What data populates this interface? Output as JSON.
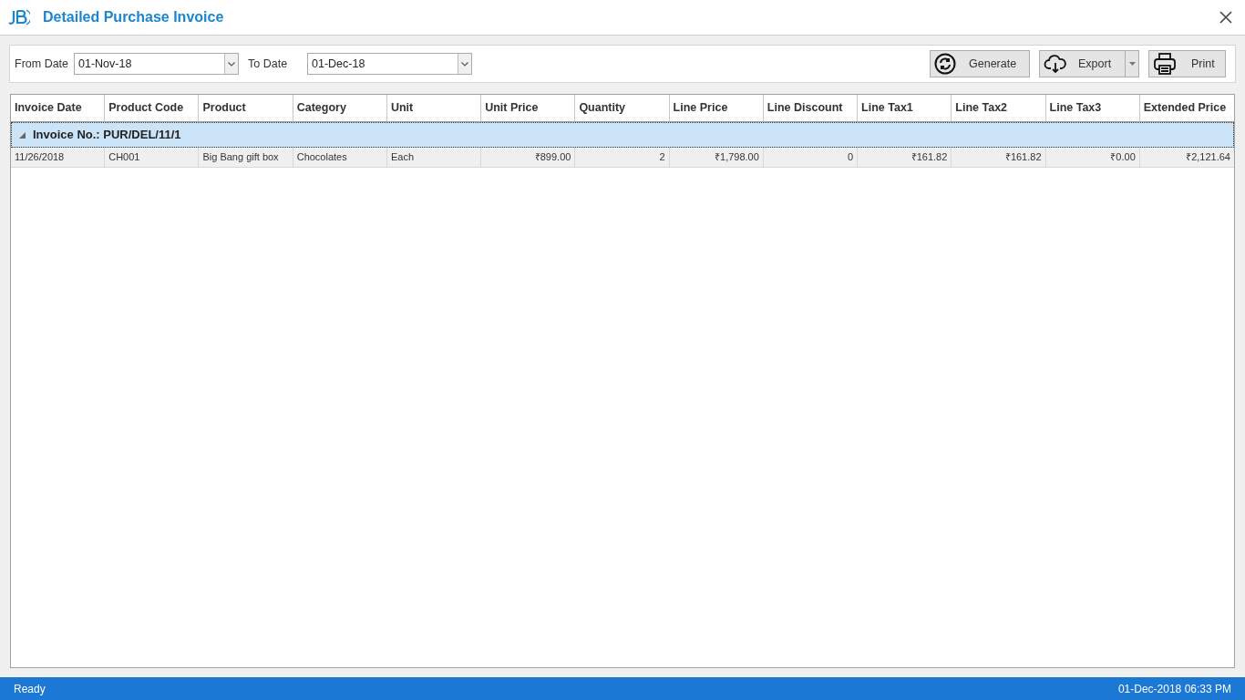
{
  "window": {
    "title": "Detailed Purchase Invoice"
  },
  "filters": [
    {
      "label": "From Date",
      "value": "01-Nov-18"
    },
    {
      "label": "To Date",
      "value": "01-Dec-18"
    }
  ],
  "buttons": [
    {
      "kind": "generate",
      "label": "Generate"
    },
    {
      "kind": "export",
      "label": "Export"
    },
    {
      "kind": "print",
      "label": "Print"
    }
  ],
  "table": {
    "columns": [
      {
        "label": "Invoice Date",
        "kind": "text"
      },
      {
        "label": "Product Code",
        "kind": "text"
      },
      {
        "label": "Product",
        "kind": "text"
      },
      {
        "label": "Category",
        "kind": "text"
      },
      {
        "label": "Unit",
        "kind": "text"
      },
      {
        "label": "Unit Price",
        "kind": "number"
      },
      {
        "label": "Quantity",
        "kind": "number"
      },
      {
        "label": "Line Price",
        "kind": "number"
      },
      {
        "label": "Line Discount",
        "kind": "number"
      },
      {
        "label": "Line Tax1",
        "kind": "number"
      },
      {
        "label": "Line Tax2",
        "kind": "number"
      },
      {
        "label": "Line Tax3",
        "kind": "number"
      },
      {
        "label": "Extended Price",
        "kind": "number"
      }
    ],
    "groups": [
      {
        "label": "Invoice No.: PUR/DEL/11/1",
        "expanded": true,
        "rows": [
          [
            "11/26/2018",
            "CH001",
            "Big Bang gift box",
            "Chocolates",
            "Each",
            "₹899.00",
            "2",
            "₹1,798.00",
            "0",
            "₹161.82",
            "₹161.82",
            "₹0.00",
            "₹2,121.64"
          ]
        ]
      }
    ]
  },
  "status_bar": {
    "left": "Ready",
    "right": "01-Dec-2018 06:33 PM"
  }
}
